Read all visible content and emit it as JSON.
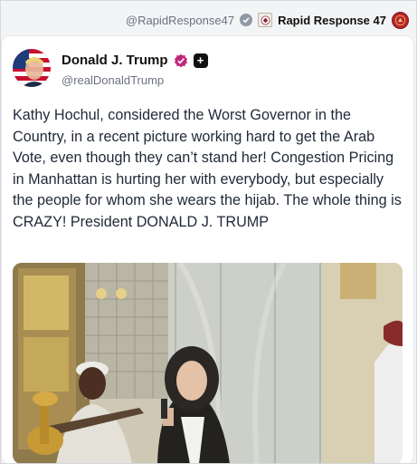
{
  "header": {
    "source_handle": "@RapidResponse47",
    "source_name": "Rapid Response 47",
    "icons": [
      "verified-badge-icon",
      "seal-icon",
      "rapid-response-logo-icon"
    ]
  },
  "post": {
    "author_name": "Donald J. Trump",
    "author_handle": "@realDonaldTrump",
    "verified_color": "#c0287b",
    "body": "Kathy Hochul, considered the Worst Governor in the Country, in a recent picture working hard to get the Arab Vote, even though they can’t stand her! Congestion Pricing in Manhattan is hurting her with everybody, but especially the people for whom she wears the hijab. The whole thing is CRAZY! President DONALD J. TRUMP",
    "icons": [
      "avatar-flag-portrait",
      "verified-badge-icon",
      "plus-icon"
    ]
  },
  "media": {
    "kind": "photo",
    "description_icon": "photo-image"
  }
}
